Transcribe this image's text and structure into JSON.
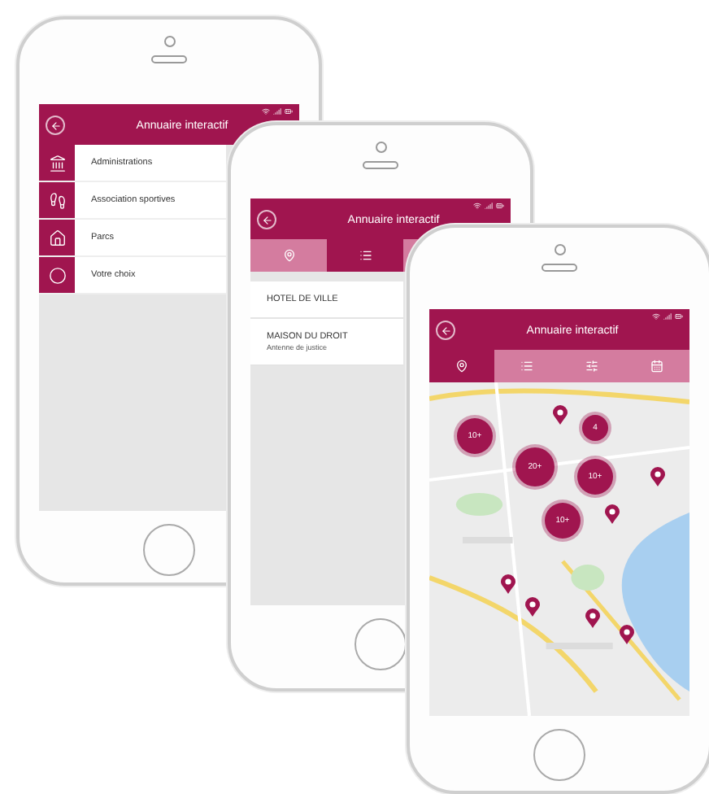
{
  "phones": [
    {
      "kind": "menu",
      "title": "Annuaire interactif",
      "items": [
        {
          "label": "Administrations"
        },
        {
          "label": "Association sportives"
        },
        {
          "label": "Parcs"
        },
        {
          "label": "Votre choix"
        }
      ]
    },
    {
      "kind": "list",
      "title": "Annuaire interactif",
      "tabs": [
        {
          "selected": false
        },
        {
          "selected": true
        }
      ],
      "rows": [
        {
          "title": "HOTEL DE VILLE"
        },
        {
          "title": "MAISON DU DROIT",
          "subtitle": "Antenne de justice"
        }
      ]
    },
    {
      "kind": "map",
      "title": "Annuaire interactif",
      "tabs": [
        {
          "selected": true
        },
        {
          "selected": false
        },
        {
          "selected": false
        },
        {
          "selected": false
        }
      ],
      "markers": [
        {
          "kind": "cluster",
          "label": "10+"
        },
        {
          "kind": "cluster",
          "label": "4"
        },
        {
          "kind": "cluster",
          "label": "20+"
        },
        {
          "kind": "cluster",
          "label": "10+"
        },
        {
          "kind": "cluster",
          "label": "10+"
        },
        {
          "kind": "pin"
        },
        {
          "kind": "pin"
        },
        {
          "kind": "pin"
        },
        {
          "kind": "pin"
        },
        {
          "kind": "pin"
        },
        {
          "kind": "pin"
        },
        {
          "kind": "pin"
        }
      ]
    }
  ]
}
